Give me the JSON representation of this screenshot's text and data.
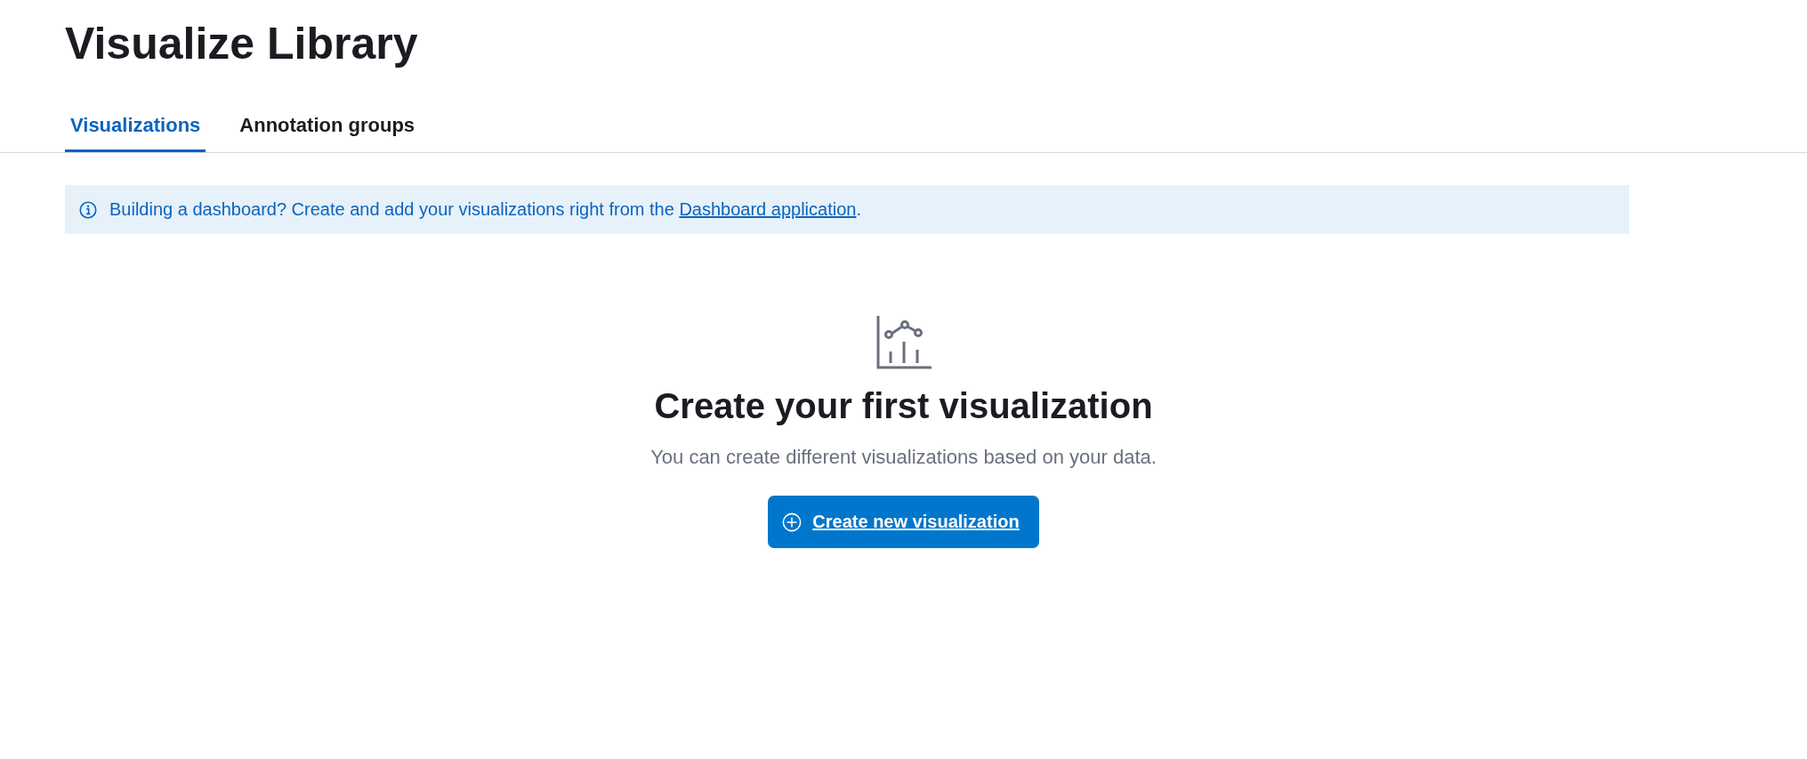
{
  "page_title": "Visualize Library",
  "tabs": [
    {
      "label": "Visualizations",
      "selected": true
    },
    {
      "label": "Annotation groups",
      "selected": false
    }
  ],
  "callout": {
    "text": "Building a dashboard? Create and add your visualizations right from the ",
    "link": "Dashboard application",
    "text_end": "."
  },
  "empty_state": {
    "heading": "Create your first visualization",
    "body": "You can create different visualizations based on your data.",
    "button": "Create new visualization"
  }
}
